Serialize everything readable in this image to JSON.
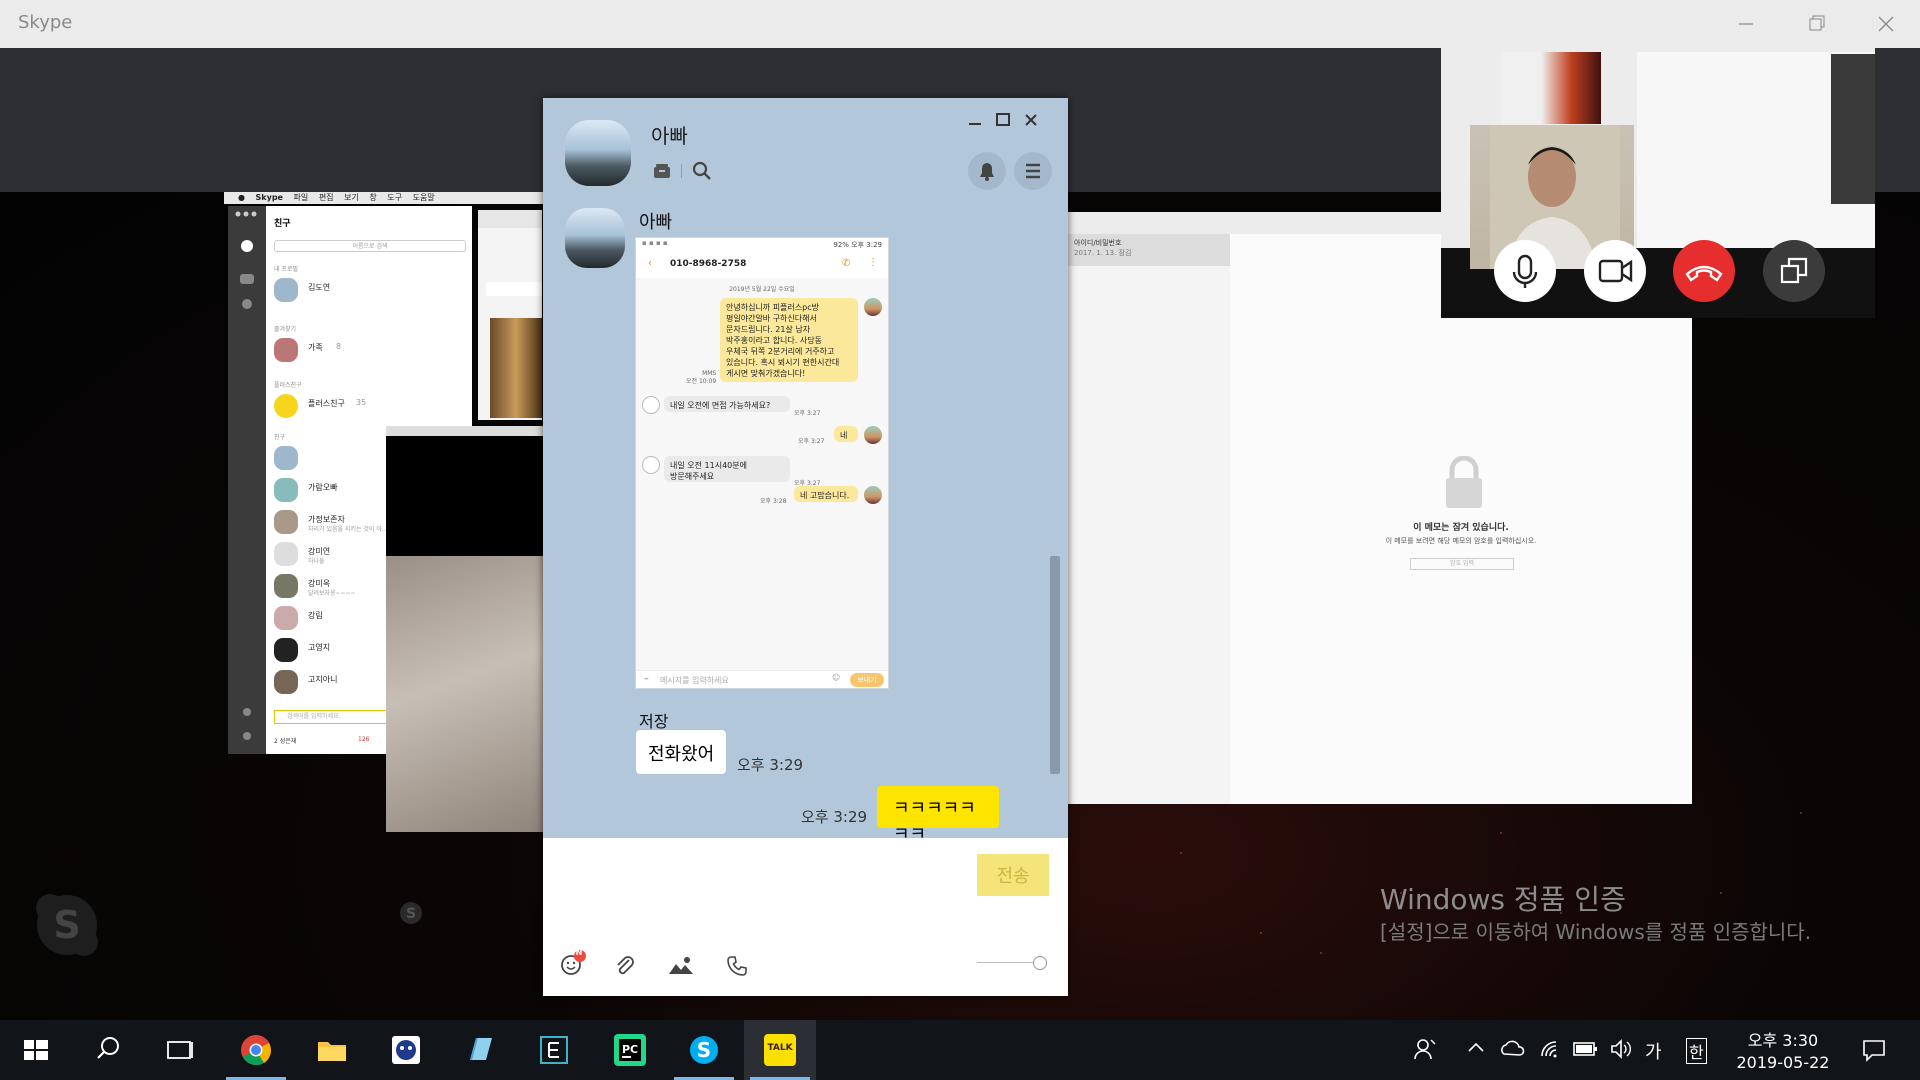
{
  "skype": {
    "window_title": "Skype"
  },
  "mac": {
    "menubar": [
      "Skype",
      "파일",
      "편집",
      "보기",
      "창",
      "도구",
      "도움말"
    ],
    "friends": {
      "title": "친구",
      "search_placeholder": "이름으로 검색",
      "my_profile_section": "내 프로필",
      "my_name": "김도연",
      "favorites_section": "즐겨찾기",
      "family": "가족",
      "family_count": "8",
      "plus_section": "플러스친구",
      "plus_friend": "플러스친구",
      "plus_count": "35",
      "friends_section": "친구",
      "friends": [
        {
          "name": "",
          "status": ""
        },
        {
          "name": "가람오빠",
          "status": ""
        },
        {
          "name": "가정보존자",
          "status": "자리가 있음을 지키는 것이 아…"
        },
        {
          "name": "강미연",
          "status": "하나둘"
        },
        {
          "name": "강미옥",
          "status": "달려보자옹~~~~"
        },
        {
          "name": "강림",
          "status": ""
        },
        {
          "name": "고영지",
          "status": ""
        },
        {
          "name": "고지아니",
          "status": ""
        }
      ],
      "search_bottom_placeholder": "검색어를 입력하세요.",
      "bottom_status": "2 성은재",
      "bottom_count": "126"
    },
    "notes": {
      "list_item_title": "아이디/비밀번호",
      "list_item_date": "2017. 1. 13.",
      "list_item_tag": "잠김",
      "locked_title": "이 메모는 잠겨 있습니다.",
      "locked_desc": "이 메모를 보려면 해당 메모의 암호를 입력하십시오.",
      "password_placeholder": "암호 입력"
    }
  },
  "kakao": {
    "room_name": "아빠",
    "sender_name": "아빠",
    "phone": {
      "status_right": "92% 오후 3:29",
      "contact_number": "010-8968-2758",
      "date_divider": "2019년 5월 22일 수요일",
      "messages": [
        {
          "dir": "out",
          "text": "안녕하십니까 피플러스pc방\n평일야간알바 구하신다해서\n문자드립니다. 21살 남자\n박주홍이라고 합니다. 사당동\n우체국 뒤쪽 2분거리에 거주하고\n있습니다. 혹시 뵈시기 편한시간대\n게시면 맞춰가겠습니다!",
          "time": "MMS\n오전 10:09"
        },
        {
          "dir": "in",
          "text": "내일 오전에 면접 가능하세요?",
          "time": "오후 3:27"
        },
        {
          "dir": "out",
          "text": "네",
          "time": "오후 3:27"
        },
        {
          "dir": "in",
          "text": "내일 오전 11시40분에\n방문해주세요",
          "time": "오후 3:27"
        },
        {
          "dir": "out",
          "text": "네 고맙습니다.",
          "time": "오후 3:28"
        }
      ],
      "input_placeholder": "메시지를 입력하세요",
      "send_label": "보내기"
    },
    "sender2_name": "저장",
    "msg_incoming_text": "전화왔어",
    "msg_incoming_time": "오후 3:29",
    "msg_outgoing_text": "ㅋㅋㅋㅋㅋㅋㅋ",
    "msg_outgoing_time": "오후 3:29",
    "send_button": "전송",
    "emoticon_badge": "N"
  },
  "watermark": {
    "title": "Windows 정품 인증",
    "desc": "[설정]으로 이동하여 Windows를 정품 인증합니다."
  },
  "taskbar": {
    "apps": [
      "start",
      "search",
      "task-view",
      "chrome",
      "file-explorer",
      "app-tiger",
      "notepad",
      "ebook",
      "pycharm",
      "skype",
      "kakaotalk"
    ],
    "kakao_icon_text": "TALK",
    "ime_mode": "가",
    "ime_lang": "한",
    "clock_time": "오후 3:30",
    "clock_date": "2019-05-22"
  }
}
